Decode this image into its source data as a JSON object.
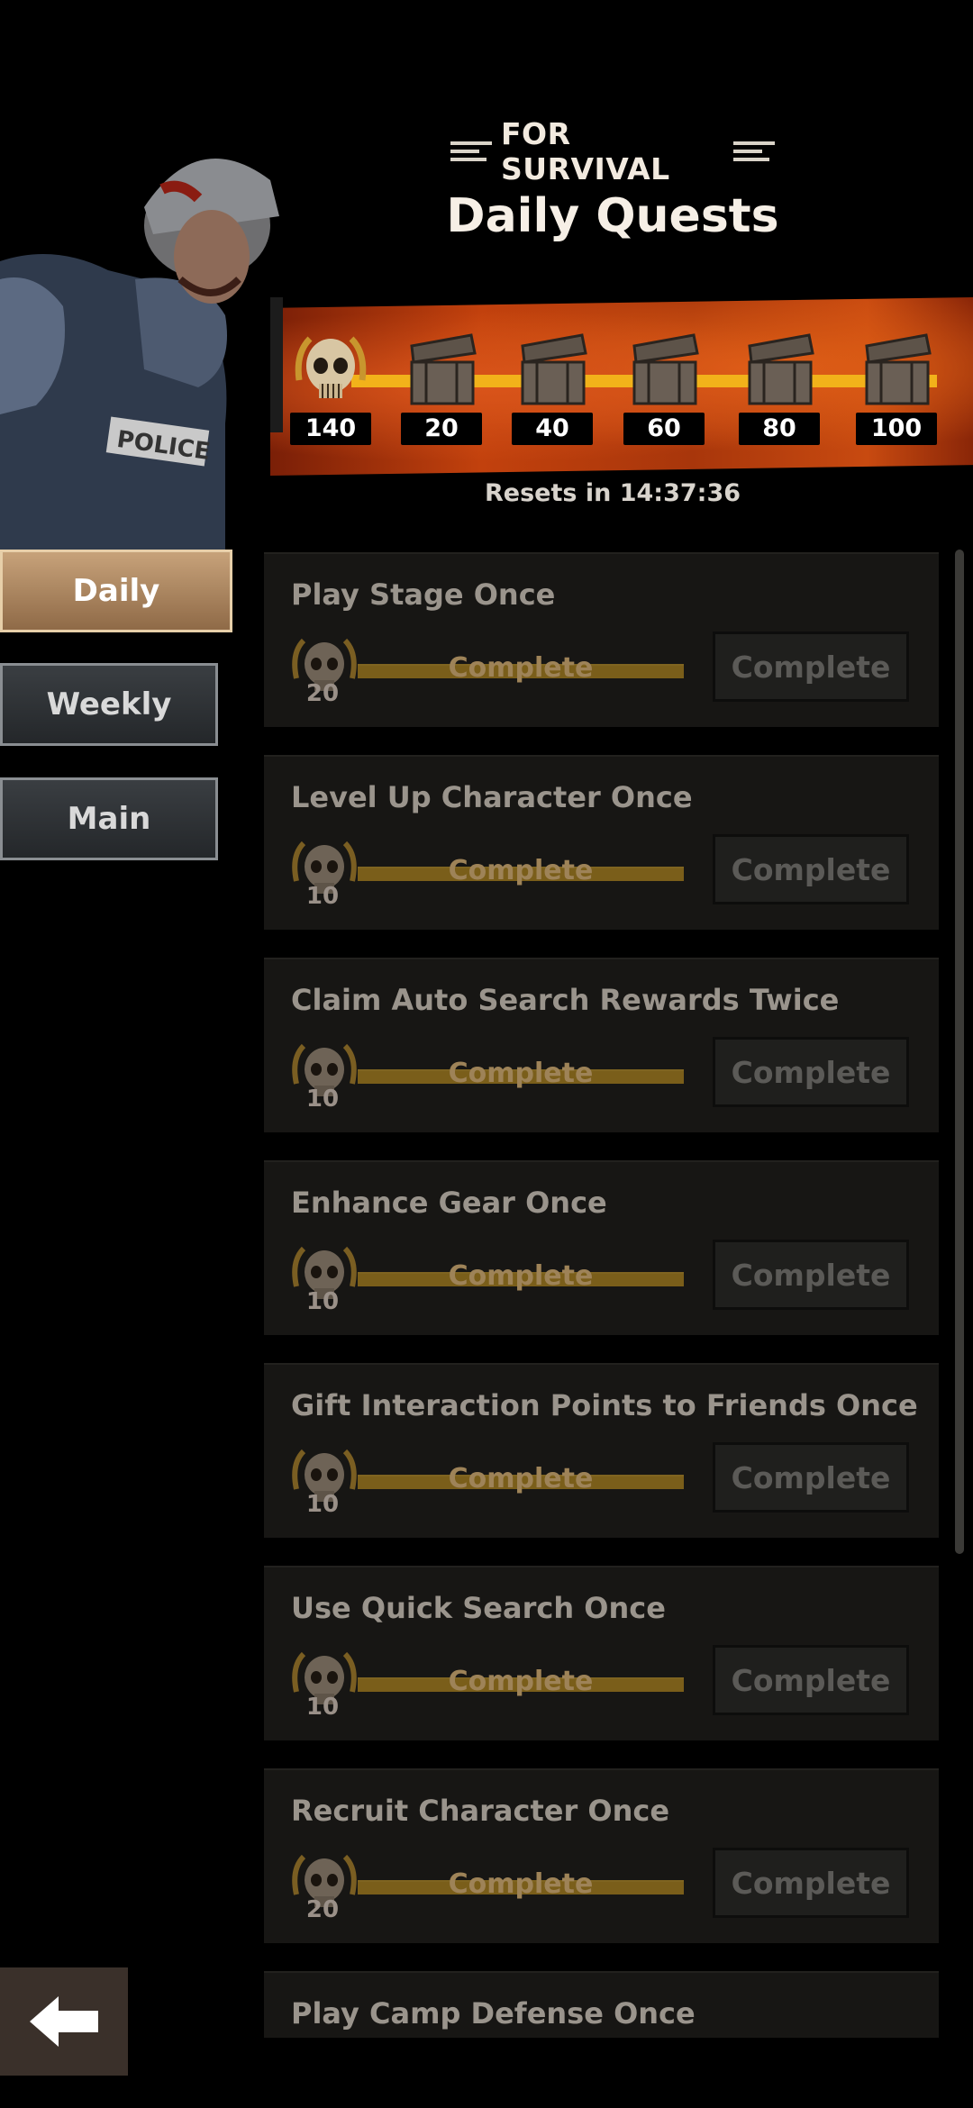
{
  "header": {
    "subtitle": "FOR SURVIVAL",
    "title": "Daily Quests"
  },
  "progress": {
    "current": "140",
    "milestones": [
      "20",
      "40",
      "60",
      "80",
      "100"
    ],
    "resets": "Resets in 14:37:36"
  },
  "tabs": [
    {
      "label": "Daily",
      "active": true
    },
    {
      "label": "Weekly",
      "active": false
    },
    {
      "label": "Main",
      "active": false
    }
  ],
  "quests": [
    {
      "title": "Play Stage Once",
      "points": "20",
      "progress_label": "Complete",
      "progress": 1.0,
      "button": "Complete"
    },
    {
      "title": "Level Up Character Once",
      "points": "10",
      "progress_label": "Complete",
      "progress": 1.0,
      "button": "Complete"
    },
    {
      "title": "Claim Auto Search Rewards Twice",
      "points": "10",
      "progress_label": "Complete",
      "progress": 1.0,
      "button": "Complete"
    },
    {
      "title": "Enhance Gear Once",
      "points": "10",
      "progress_label": "Complete",
      "progress": 1.0,
      "button": "Complete"
    },
    {
      "title": "Gift Interaction Points to Friends Once",
      "points": "10",
      "progress_label": "Complete",
      "progress": 1.0,
      "button": "Complete"
    },
    {
      "title": "Use Quick Search Once",
      "points": "10",
      "progress_label": "Complete",
      "progress": 1.0,
      "button": "Complete"
    },
    {
      "title": "Recruit Character Once",
      "points": "20",
      "progress_label": "Complete",
      "progress": 1.0,
      "button": "Complete"
    },
    {
      "title": "Play Camp Defense Once"
    }
  ],
  "icons": {
    "points": "skull-medal-icon",
    "milestone": "chest-icon",
    "back": "back-arrow-icon"
  },
  "colors": {
    "accent": "#f2b21a",
    "band": "#c2410d",
    "active_tab": "#b08a62"
  }
}
